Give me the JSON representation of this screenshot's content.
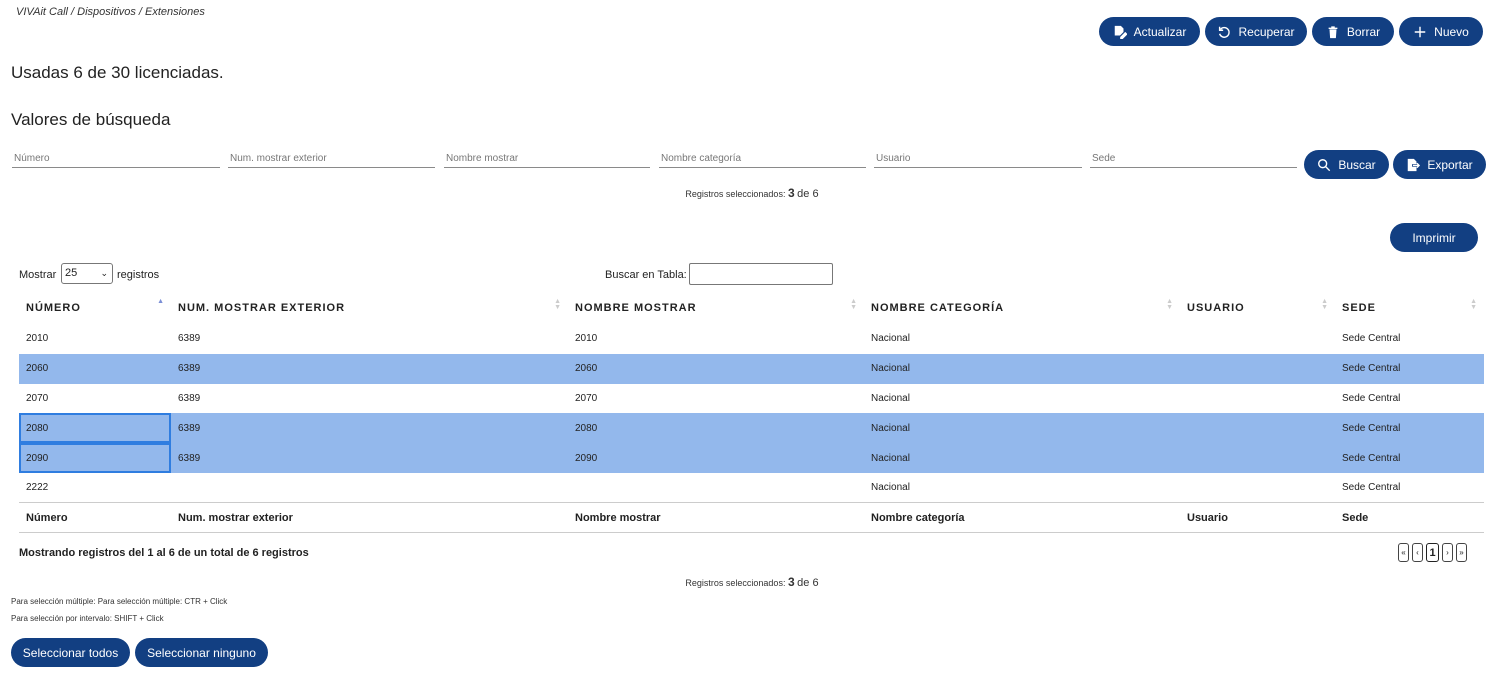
{
  "breadcrumb": "VIVAit Call / Dispositivos / Extensiones",
  "toolbar": {
    "update_label": "Actualizar",
    "recover_label": "Recuperar",
    "delete_label": "Borrar",
    "new_label": "Nuevo"
  },
  "license_text": "Usadas 6 de 30 licenciadas.",
  "search": {
    "title": "Valores de búsqueda",
    "placeholders": {
      "numero": "Número",
      "num_exterior": "Num. mostrar exterior",
      "nombre": "Nombre mostrar",
      "categoria": "Nombre categoría",
      "usuario": "Usuario",
      "sede": "Sede"
    },
    "search_label": "Buscar",
    "export_label": "Exportar"
  },
  "selection": {
    "prefix": "Registros seleccionados:",
    "count": "3",
    "of": "de 6"
  },
  "print_label": "Imprimir",
  "table_controls": {
    "show_label": "Mostrar",
    "page_size": "25",
    "records_label": "registros",
    "search_label": "Buscar en Tabla:"
  },
  "table": {
    "headers": [
      "NÚMERO",
      "NUM. MOSTRAR EXTERIOR",
      "NOMBRE MOSTRAR",
      "NOMBRE CATEGORÍA",
      "USUARIO",
      "SEDE"
    ],
    "footers": [
      "Número",
      "Num. mostrar exterior",
      "Nombre mostrar",
      "Nombre categoría",
      "Usuario",
      "Sede"
    ],
    "rows": [
      [
        "2010",
        "6389",
        "2010",
        "Nacional",
        "",
        "Sede Central"
      ],
      [
        "2060",
        "6389",
        "2060",
        "Nacional",
        "",
        "Sede Central"
      ],
      [
        "2070",
        "6389",
        "2070",
        "Nacional",
        "",
        "Sede Central"
      ],
      [
        "2080",
        "6389",
        "2080",
        "Nacional",
        "",
        "Sede Central"
      ],
      [
        "2090",
        "6389",
        "2090",
        "Nacional",
        "",
        "Sede Central"
      ],
      [
        "2222",
        "",
        "",
        "Nacional",
        "",
        "Sede Central"
      ]
    ]
  },
  "table_info": "Mostrando registros del 1 al 6 de un total de 6 registros",
  "pager": {
    "first": "«",
    "prev": "‹",
    "current": "1",
    "next": "›",
    "last": "»"
  },
  "hints": {
    "multi": "Para selección múltiple: Para selección múltiple: CTR + Click",
    "range": "Para selección por intervalo: SHIFT + Click"
  },
  "select_all_label": "Seleccionar todos",
  "select_none_label": "Seleccionar ninguno",
  "colors": {
    "primary": "#123f82",
    "selected_row": "#93b8ec",
    "focus_border": "#2f7de0"
  }
}
